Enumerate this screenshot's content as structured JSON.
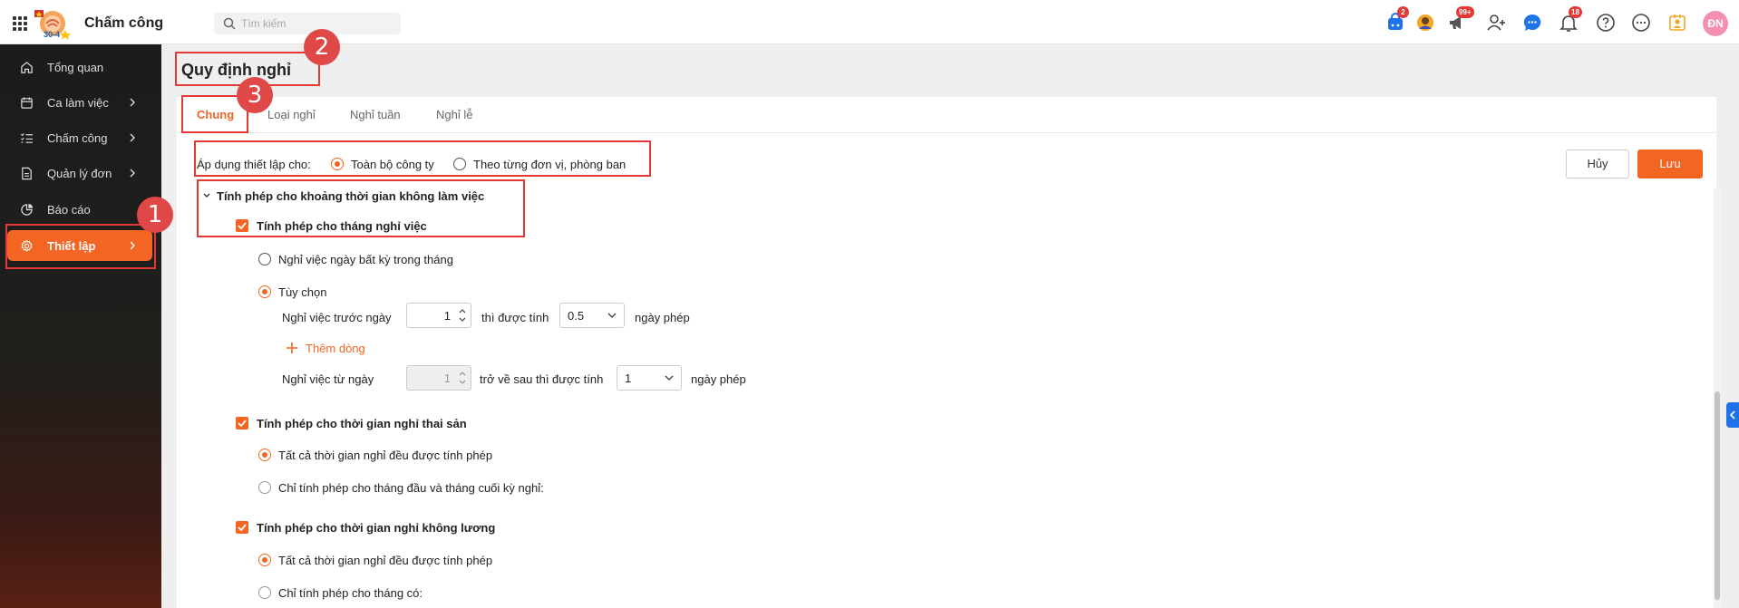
{
  "app": {
    "title": "Chấm công",
    "logo_text": "30-4"
  },
  "search": {
    "placeholder": "Tìm kiếm"
  },
  "header_icons": [
    {
      "name": "cart-icon",
      "badge": "2"
    },
    {
      "name": "avatar-group-icon",
      "badge": ""
    },
    {
      "name": "megaphone-icon",
      "badge": "99+"
    },
    {
      "name": "add-user-icon",
      "badge": ""
    },
    {
      "name": "chat-icon",
      "badge": ""
    },
    {
      "name": "bell-icon",
      "badge": "18"
    },
    {
      "name": "help-icon",
      "badge": ""
    },
    {
      "name": "more-icon",
      "badge": ""
    },
    {
      "name": "contact-icon",
      "badge": ""
    }
  ],
  "user": {
    "initials": "ĐN"
  },
  "sidebar": {
    "items": [
      {
        "label": "Tổng quan",
        "icon": "home-icon",
        "has_chevron": false
      },
      {
        "label": "Ca làm việc",
        "icon": "calendar-icon",
        "has_chevron": true
      },
      {
        "label": "Chấm công",
        "icon": "checklist-icon",
        "has_chevron": true
      },
      {
        "label": "Quản lý đơn",
        "icon": "document-icon",
        "has_chevron": true
      },
      {
        "label": "Báo cáo",
        "icon": "pie-chart-icon",
        "has_chevron": false
      },
      {
        "label": "Thiết lập",
        "icon": "gear-icon",
        "has_chevron": true,
        "active": true
      }
    ]
  },
  "page": {
    "title": "Quy định nghỉ"
  },
  "tabs": [
    {
      "label": "Chung",
      "active": true
    },
    {
      "label": "Loại nghỉ"
    },
    {
      "label": "Nghỉ tuần"
    },
    {
      "label": "Nghỉ lễ"
    }
  ],
  "apply": {
    "label": "Áp dụng thiết lập cho:",
    "options": [
      "Toàn bộ công ty",
      "Theo từng đơn vị, phòng ban"
    ],
    "selected": "Toàn bộ công ty"
  },
  "actions": {
    "cancel": "Hủy",
    "save": "Lưu"
  },
  "section": {
    "title": "Tính phép cho khoảng thời gian không làm việc",
    "resign": {
      "label": "Tính phép cho tháng nghỉ việc",
      "checked": true,
      "option_any": "Nghỉ việc ngày bất kỳ trong tháng",
      "option_custom": "Tùy chọn",
      "selected": "Tùy chọn",
      "rule1": {
        "prefix": "Nghỉ việc trước ngày",
        "day": "1",
        "middle": "thì được tính",
        "value": "0.5",
        "suffix": "ngày phép"
      },
      "add_line": "Thêm dòng",
      "rule2": {
        "prefix": "Nghỉ việc từ ngày",
        "day": "1",
        "middle": "trở về sau thì được tính",
        "value": "1",
        "suffix": "ngày phép"
      }
    },
    "maternity": {
      "label": "Tính phép cho thời gian nghỉ thai sản",
      "checked": true,
      "option_all": "Tất cả thời gian nghỉ đều được tính phép",
      "option_partial": "Chỉ tính phép cho tháng đầu và tháng cuối kỳ nghỉ:",
      "selected": "Tất cả thời gian nghỉ đều được tính phép"
    },
    "unpaid": {
      "label": "Tính phép cho thời gian nghỉ không lương",
      "checked": true,
      "option_all": "Tất cả thời gian nghỉ đều được tính phép",
      "option_partial": "Chỉ tính phép cho tháng có:",
      "selected": "Tất cả thời gian nghỉ đều được tính phép"
    }
  },
  "annotations": {
    "marker1": "1",
    "marker2": "2",
    "marker3": "3"
  },
  "colors": {
    "accent": "#f26522",
    "annotation": "#e53935",
    "sidebar_bg": "#1c1c1c"
  }
}
